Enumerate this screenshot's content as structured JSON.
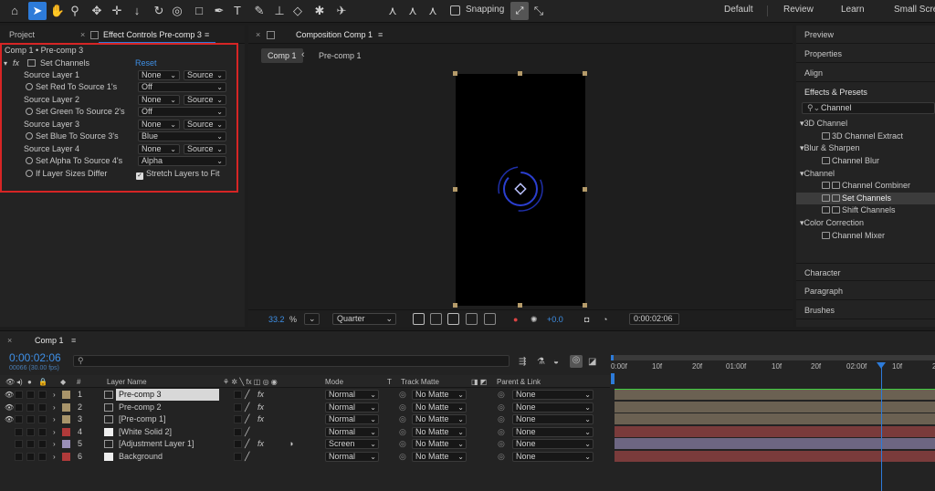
{
  "toolbar": {
    "snapping_label": "Snapping",
    "workspaces": [
      "Default",
      "Review",
      "Learn",
      "Small Screen"
    ]
  },
  "effect_controls": {
    "tabs": {
      "project": "Project",
      "effect_controls": "Effect Controls Pre-comp 3"
    },
    "breadcrumb": "Comp 1 • Pre-comp 3",
    "effect_name": "Set Channels",
    "reset_label": "Reset",
    "rows": [
      {
        "label": "Source Layer 1",
        "value": "None",
        "value2": "Source"
      },
      {
        "label": "Set Red To Source 1's",
        "value": "Off"
      },
      {
        "label": "Source Layer 2",
        "value": "None",
        "value2": "Source"
      },
      {
        "label": "Set Green To Source 2's",
        "value": "Off"
      },
      {
        "label": "Source Layer 3",
        "value": "None",
        "value2": "Source"
      },
      {
        "label": "Set Blue To Source 3's",
        "value": "Blue"
      },
      {
        "label": "Source Layer 4",
        "value": "None",
        "value2": "Source"
      },
      {
        "label": "Set Alpha To Source 4's",
        "value": "Alpha"
      },
      {
        "label": "If Layer Sizes Differ",
        "value": "Stretch Layers to Fit"
      }
    ]
  },
  "composition": {
    "tab": "Composition Comp 1",
    "crumb_active": "Comp 1",
    "crumb_next": "Pre-comp 1",
    "zoom": "33.2",
    "zoom_unit": "%",
    "resolution": "Quarter",
    "exposure": "+0.0",
    "timecode": "0:00:02:06"
  },
  "right_panels": {
    "preview": "Preview",
    "properties": "Properties",
    "align": "Align",
    "effects_presets": "Effects & Presets",
    "search_value": "Channel",
    "tree": [
      {
        "type": "cat",
        "label": "3D Channel"
      },
      {
        "type": "item",
        "label": "3D Channel Extract"
      },
      {
        "type": "cat",
        "label": "Blur & Sharpen"
      },
      {
        "type": "item",
        "label": "Channel Blur"
      },
      {
        "type": "cat",
        "label": "Channel"
      },
      {
        "type": "item",
        "label": "Channel Combiner"
      },
      {
        "type": "item",
        "label": "Set Channels",
        "selected": true
      },
      {
        "type": "item",
        "label": "Shift Channels"
      },
      {
        "type": "cat",
        "label": "Color Correction"
      },
      {
        "type": "item",
        "label": "Channel Mixer"
      }
    ],
    "character": "Character",
    "paragraph": "Paragraph",
    "brushes": "Brushes"
  },
  "timeline": {
    "tab": "Comp 1",
    "time": "0:00:02:06",
    "fps": "00066 (30.00 fps)",
    "columns": {
      "num": "#",
      "layer_name": "Layer Name",
      "mode": "Mode",
      "t": "T",
      "track_matte": "Track Matte",
      "parent": "Parent & Link"
    },
    "layers": [
      {
        "num": "1",
        "name": "Pre-comp 3",
        "mode": "Normal",
        "matte": "No Matte",
        "parent": "None",
        "color": "#a8946a",
        "fx": true,
        "selected": true
      },
      {
        "num": "2",
        "name": "Pre-comp 2",
        "mode": "Normal",
        "matte": "No Matte",
        "parent": "None",
        "color": "#a8946a",
        "fx": true
      },
      {
        "num": "3",
        "name": "[Pre-comp 1]",
        "mode": "Normal",
        "matte": "No Matte",
        "parent": "None",
        "color": "#a8946a",
        "fx": true
      },
      {
        "num": "4",
        "name": "[White Solid 2]",
        "mode": "Normal",
        "matte": "No Matte",
        "parent": "None",
        "color": "#b03a3a",
        "fx": false
      },
      {
        "num": "5",
        "name": "[Adjustment Layer 1]",
        "mode": "Screen",
        "matte": "No Matte",
        "parent": "None",
        "color": "#9a8fb8",
        "fx": true
      },
      {
        "num": "6",
        "name": "Background",
        "mode": "Normal",
        "matte": "No Matte",
        "parent": "None",
        "color": "#b03a3a",
        "fx": false
      }
    ],
    "ruler": [
      "0:00f",
      "10f",
      "20f",
      "01:00f",
      "10f",
      "20f",
      "02:00f",
      "10f",
      "2"
    ]
  }
}
